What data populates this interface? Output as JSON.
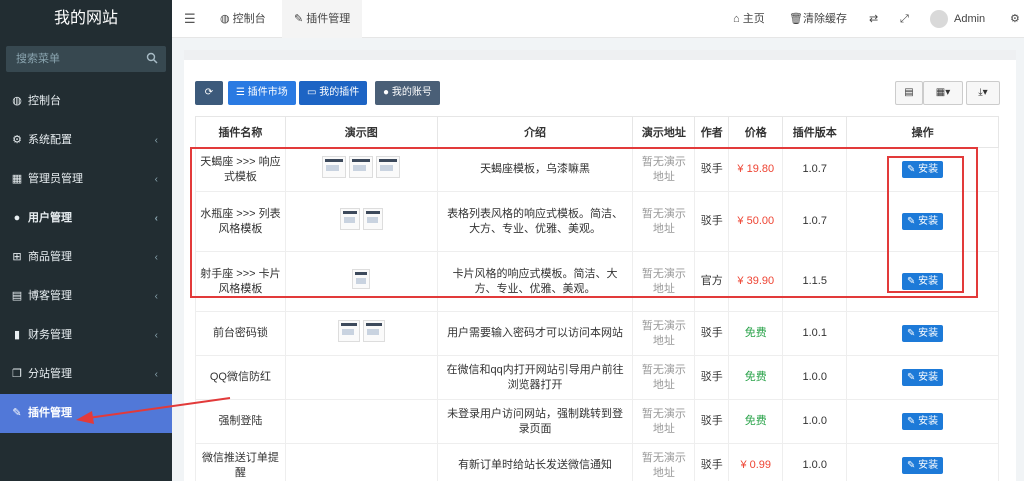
{
  "brand": "我的网站",
  "search": {
    "placeholder": "搜索菜单"
  },
  "sidebar": {
    "items": [
      {
        "label": "控制台",
        "icon": "dashboard-icon"
      },
      {
        "label": "系统配置",
        "icon": "gears-icon"
      },
      {
        "label": "管理员管理",
        "icon": "windows-icon"
      },
      {
        "label": "用户管理",
        "icon": "user-icon"
      },
      {
        "label": "商品管理",
        "icon": "cart-icon"
      },
      {
        "label": "博客管理",
        "icon": "book-icon"
      },
      {
        "label": "财务管理",
        "icon": "bookmark-icon"
      },
      {
        "label": "分站管理",
        "icon": "window-restore-icon"
      },
      {
        "label": "插件管理",
        "icon": "wrench-icon"
      }
    ]
  },
  "header": {
    "tabs": [
      {
        "label": "控制台",
        "icon": "dashboard-icon"
      },
      {
        "label": "插件管理",
        "icon": "wrench-icon"
      }
    ],
    "home": "主页",
    "clear_cache": "清除缓存",
    "user": "Admin"
  },
  "toolbar": {
    "market": "插件市场",
    "mine": "我的插件",
    "account": "我的账号"
  },
  "table": {
    "headers": [
      "插件名称",
      "演示图",
      "介绍",
      "演示地址",
      "作者",
      "价格",
      "插件版本",
      "操作"
    ],
    "install_label": "安装",
    "rows": [
      {
        "name": "天蝎座 >>> 响应式模板",
        "intro": "天蝎座模板，乌漆嘛黑",
        "demo": "暂无演示地址",
        "author": "驳手",
        "price": "¥ 19.80",
        "version": "1.0.7"
      },
      {
        "name": "水瓶座 >>> 列表风格模板",
        "intro": "表格列表风格的响应式模板。简洁、大方、专业、优雅、美观。",
        "demo": "暂无演示地址",
        "author": "驳手",
        "price": "¥ 50.00",
        "version": "1.0.7"
      },
      {
        "name": "射手座 >>> 卡片风格模板",
        "intro": "卡片风格的响应式模板。简洁、大方、专业、优雅、美观。",
        "demo": "暂无演示地址",
        "author": "官方",
        "price": "¥ 39.90",
        "version": "1.1.5"
      },
      {
        "name": "前台密码锁",
        "intro": "用户需要输入密码才可以访问本网站",
        "demo": "暂无演示地址",
        "author": "驳手",
        "price": "免费",
        "version": "1.0.1"
      },
      {
        "name": "QQ微信防红",
        "intro": "在微信和qq内打开网站引导用户前往浏览器打开",
        "demo": "暂无演示地址",
        "author": "驳手",
        "price": "免费",
        "version": "1.0.0"
      },
      {
        "name": "强制登陆",
        "intro": "未登录用户访问网站，强制跳转到登录页面",
        "demo": "暂无演示地址",
        "author": "驳手",
        "price": "免费",
        "version": "1.0.0"
      },
      {
        "name": "微信推送订单提醒",
        "intro": "有新订单时给站长发送微信通知",
        "demo": "暂无演示地址",
        "author": "驳手",
        "price": "¥ 0.99",
        "version": "1.0.0"
      }
    ]
  },
  "colors": {
    "sidebar_bg": "#222d32",
    "active_menu": "#5178d8",
    "install_btn": "#1d7ad8",
    "highlight": "#e23a3a"
  }
}
